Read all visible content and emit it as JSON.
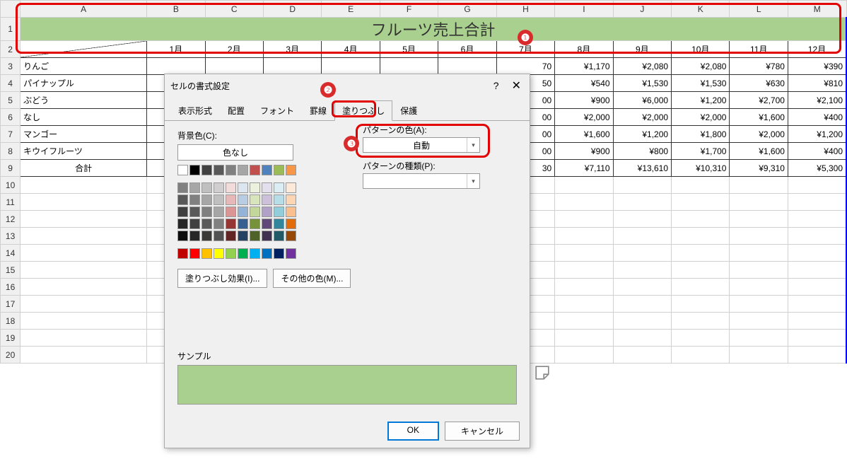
{
  "columns": [
    "A",
    "B",
    "C",
    "D",
    "E",
    "F",
    "G",
    "H",
    "I",
    "J",
    "K",
    "L",
    "M"
  ],
  "title": "フルーツ売上合計",
  "months": [
    "1月",
    "2月",
    "3月",
    "4月",
    "5月",
    "6月",
    "7月",
    "8月",
    "9月",
    "10月",
    "11月",
    "12月"
  ],
  "rows": [
    {
      "label": "りんご",
      "vis": [
        "70",
        "¥1,170",
        "¥2,080",
        "¥2,080",
        "¥780",
        "¥390"
      ]
    },
    {
      "label": "パイナップル",
      "vis": [
        "50",
        "¥540",
        "¥1,530",
        "¥1,530",
        "¥630",
        "¥810"
      ]
    },
    {
      "label": "ぶどう",
      "vis": [
        "00",
        "¥900",
        "¥6,000",
        "¥1,200",
        "¥2,700",
        "¥2,100"
      ]
    },
    {
      "label": "なし",
      "vis": [
        "00",
        "¥2,000",
        "¥2,000",
        "¥2,000",
        "¥1,600",
        "¥400"
      ]
    },
    {
      "label": "マンゴー",
      "vis": [
        "00",
        "¥1,600",
        "¥1,200",
        "¥1,800",
        "¥2,000",
        "¥1,200"
      ]
    },
    {
      "label": "キウイフルーツ",
      "vis": [
        "00",
        "¥900",
        "¥800",
        "¥1,700",
        "¥1,600",
        "¥400"
      ]
    }
  ],
  "total": {
    "label": "合計",
    "partial": "¥",
    "vis": [
      "30",
      "¥7,110",
      "¥13,610",
      "¥10,310",
      "¥9,310",
      "¥5,300"
    ]
  },
  "dialog": {
    "title": "セルの書式設定",
    "tabs": [
      "表示形式",
      "配置",
      "フォント",
      "罫線",
      "塗りつぶし",
      "保護"
    ],
    "bg_label": "背景色(C):",
    "nocolor": "色なし",
    "pattern_color_label": "パターンの色(A):",
    "pattern_color_value": "自動",
    "pattern_type_label": "パターンの種類(P):",
    "effects": "塗りつぶし効果(I)...",
    "more": "その他の色(M)...",
    "sample": "サンプル",
    "ok": "OK",
    "cancel": "キャンセル"
  },
  "palette": {
    "row1": [
      "#ffffff",
      "#000000",
      "#404040",
      "#595959",
      "#808080",
      "#a6a6a6",
      "#c0504d",
      "#4f81bd",
      "#9bbb59",
      "#f79646"
    ],
    "themeRows": [
      [
        "#808080",
        "#a6a6a6",
        "#bfbfbf",
        "#d0cece",
        "#f2dcdb",
        "#dce6f1",
        "#ebf1dd",
        "#e4dfec",
        "#daeef3",
        "#fde9d9"
      ],
      [
        "#595959",
        "#808080",
        "#a6a6a6",
        "#bfbfbf",
        "#e6b8b7",
        "#b8cce4",
        "#d8e4bc",
        "#ccc0da",
        "#b7dee8",
        "#fcd5b4"
      ],
      [
        "#404040",
        "#595959",
        "#808080",
        "#a6a6a6",
        "#da9694",
        "#95b3d7",
        "#c4d79b",
        "#b1a0c7",
        "#92cddc",
        "#fabf8f"
      ],
      [
        "#262626",
        "#404040",
        "#595959",
        "#808080",
        "#963634",
        "#366092",
        "#76933c",
        "#60497a",
        "#31869b",
        "#e26b0a"
      ],
      [
        "#0d0d0d",
        "#262626",
        "#3b3838",
        "#525252",
        "#632523",
        "#244062",
        "#4f6228",
        "#403151",
        "#215967",
        "#974706"
      ]
    ],
    "standard": [
      "#c00000",
      "#ff0000",
      "#ffc000",
      "#ffff00",
      "#92d050",
      "#00b050",
      "#00b0f0",
      "#0070c0",
      "#002060",
      "#7030a0"
    ]
  }
}
